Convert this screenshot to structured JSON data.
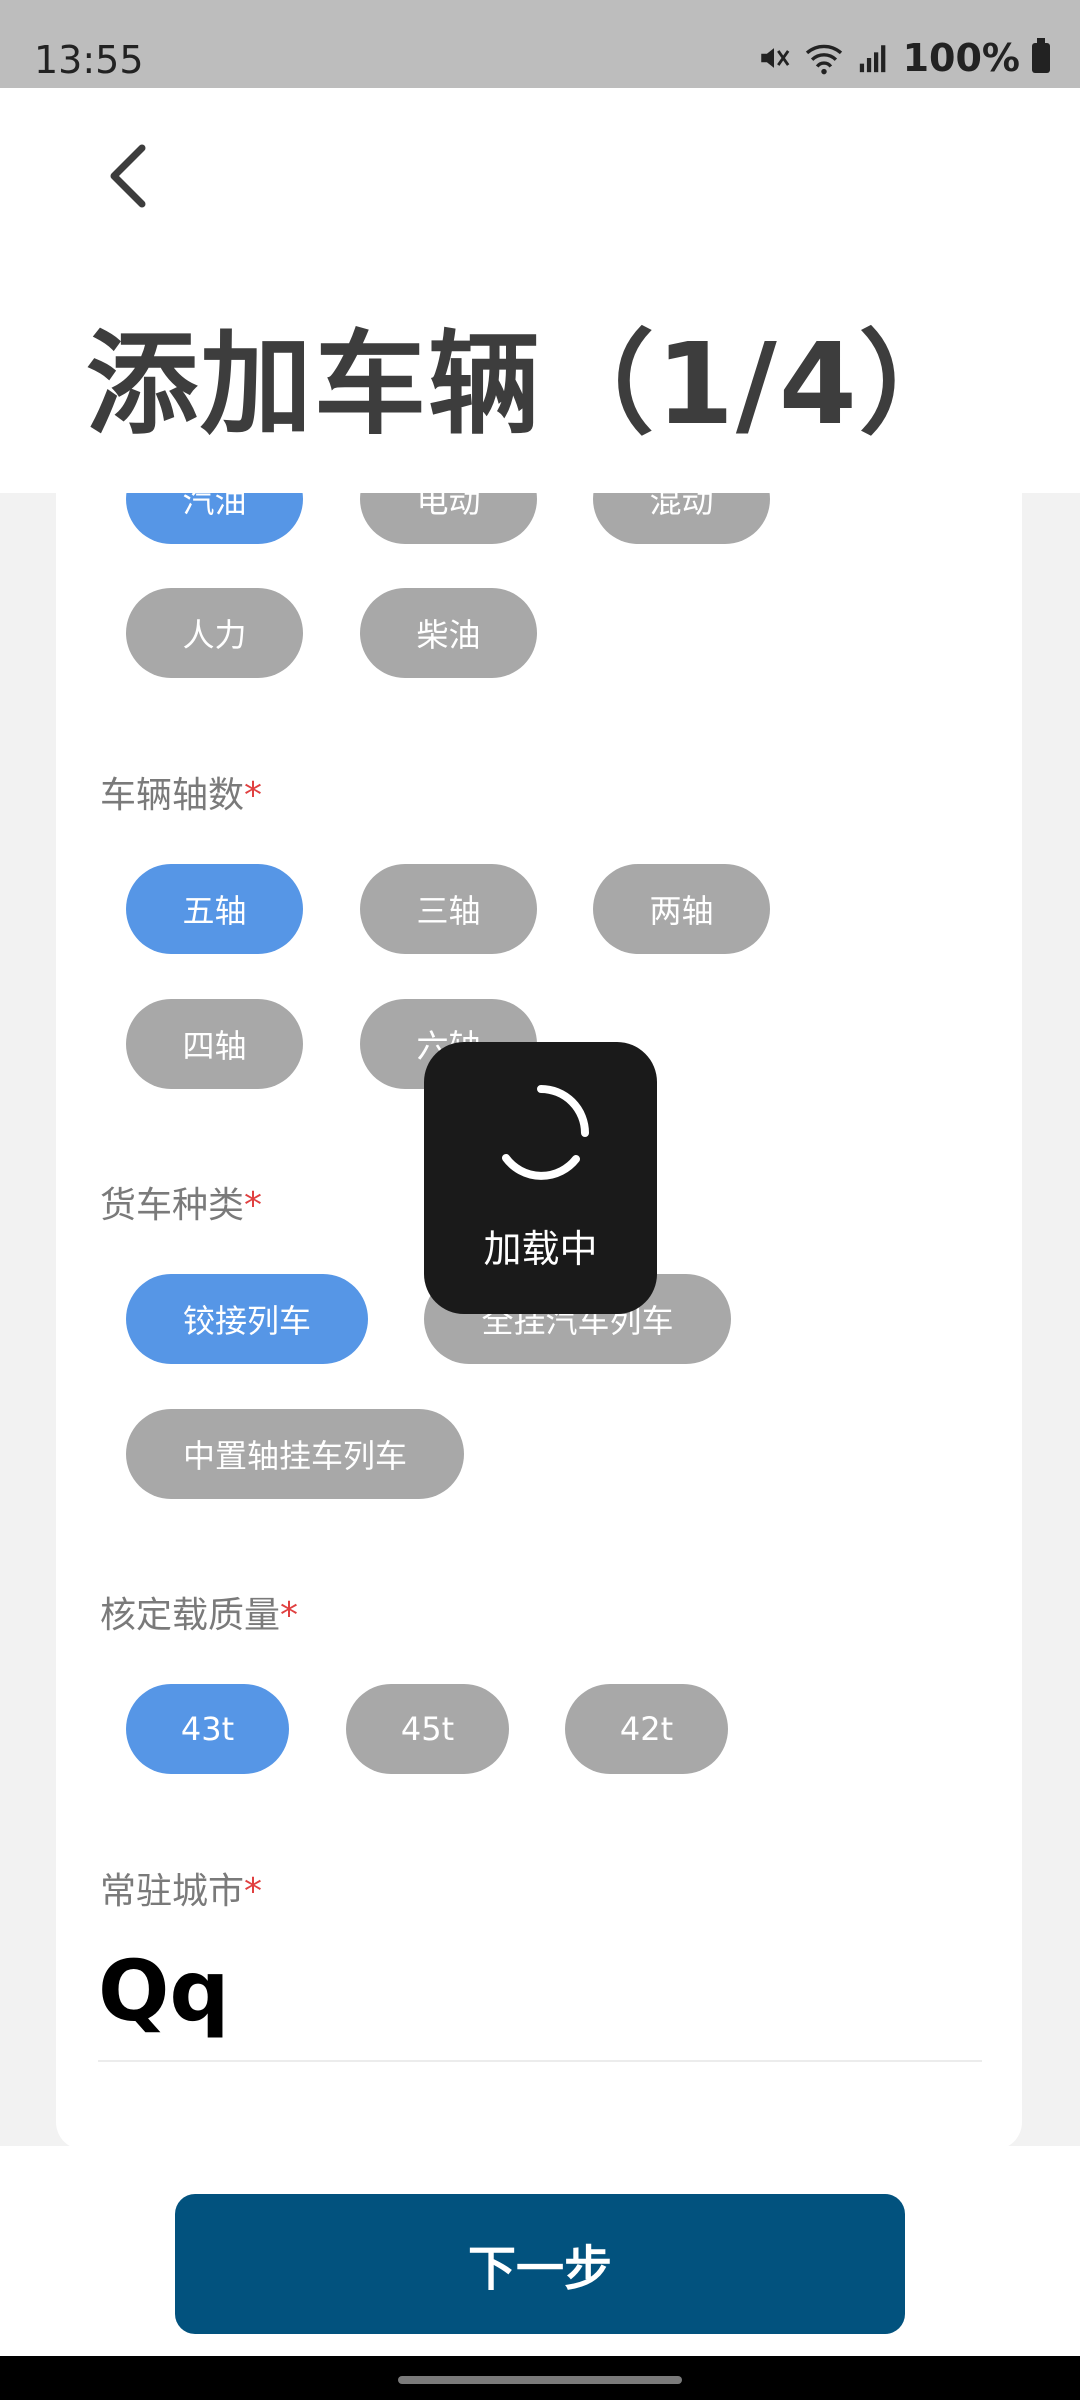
{
  "status_bar": {
    "time": "13:55",
    "battery": "100%",
    "icons": [
      "mute-icon",
      "wifi-icon",
      "signal-icon",
      "battery-icon"
    ]
  },
  "header": {
    "title": "添加车辆（1/4）",
    "back_icon": "chevron-left-icon"
  },
  "fuel_type": {
    "options": [
      "汽油",
      "电动",
      "混动",
      "人力",
      "柴油"
    ],
    "selected": "汽油"
  },
  "axle_count": {
    "label": "车辆轴数",
    "required_mark": "*",
    "options": [
      "五轴",
      "三轴",
      "两轴",
      "四轴",
      "六轴"
    ],
    "selected": "五轴"
  },
  "truck_type": {
    "label": "货车种类",
    "required_mark": "*",
    "options": [
      "铰接列车",
      "全挂汽车列车",
      "中置轴挂车列车"
    ],
    "selected": "铰接列车"
  },
  "rated_load": {
    "label": "核定载质量",
    "required_mark": "*",
    "options": [
      "43t",
      "45t",
      "42t"
    ],
    "selected": "43t"
  },
  "resident_city": {
    "label": "常驻城市",
    "required_mark": "*",
    "value": "Qq"
  },
  "footer": {
    "next_label": "下一步"
  },
  "loading": {
    "text": "加载中"
  },
  "colors": {
    "selected_chip": "#5696e6",
    "unselected_chip": "#a8a8a8",
    "primary_button": "#02527e",
    "required": "#e04040"
  }
}
